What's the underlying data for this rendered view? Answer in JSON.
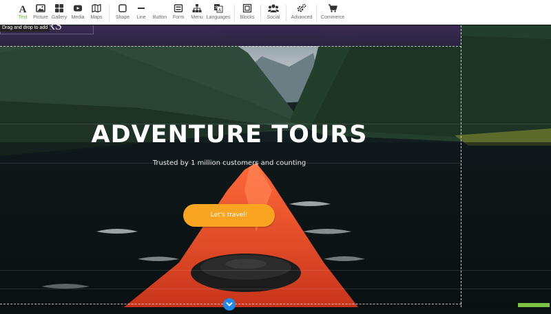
{
  "toolbar": {
    "items": [
      {
        "label": "Text",
        "icon": "text-icon"
      },
      {
        "label": "Picture",
        "icon": "picture-icon"
      },
      {
        "label": "Gallery",
        "icon": "gallery-icon"
      },
      {
        "label": "Media",
        "icon": "media-icon"
      },
      {
        "label": "Maps",
        "icon": "maps-icon"
      },
      {
        "label": "Shape",
        "icon": "shape-icon"
      },
      {
        "label": "Line",
        "icon": "line-icon"
      },
      {
        "label": "Button",
        "icon": "button-icon"
      },
      {
        "label": "Form",
        "icon": "form-icon"
      },
      {
        "label": "Menu",
        "icon": "menu-icon"
      },
      {
        "label": "Languages",
        "icon": "languages-icon"
      },
      {
        "label": "Blocks",
        "icon": "blocks-icon"
      },
      {
        "label": "Social",
        "icon": "social-icon"
      },
      {
        "label": "Advanced",
        "icon": "advanced-icon"
      },
      {
        "label": "Commerce",
        "icon": "commerce-icon"
      }
    ],
    "active_color": "#6cb33f"
  },
  "tooltip": "Drag and drop to add",
  "logo": {
    "text": "RS"
  },
  "hero": {
    "title": "ADVENTURE TOURS",
    "subtitle": "Trusted by 1 million customers and counting",
    "cta": "Let's travel!",
    "cta_color": "#f9a521"
  },
  "scroll_button": {
    "icon": "chevron-down-icon",
    "color": "#1e88e5"
  }
}
